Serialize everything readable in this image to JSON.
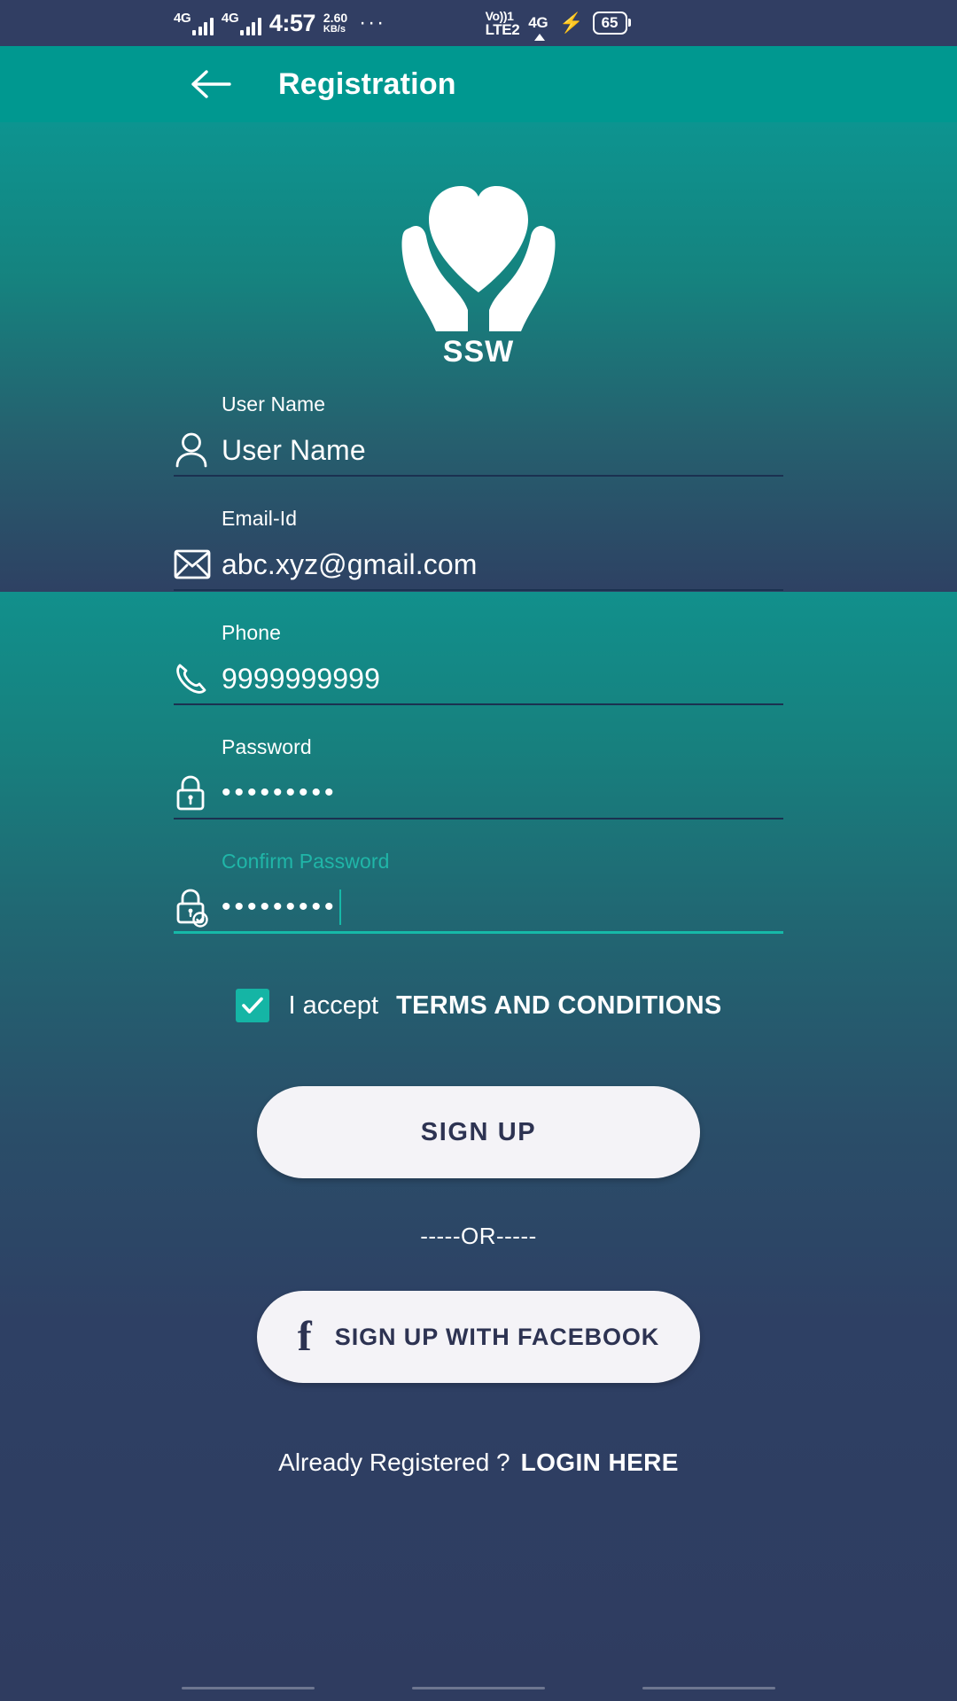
{
  "status_bar": {
    "network_1": "4G",
    "network_2": "4G",
    "time": "4:57",
    "data_rate_value": "2.60",
    "data_rate_unit": "KB/s",
    "overflow": "···",
    "volte_top": "Vo))1",
    "volte_bottom": "LTE2",
    "network_right": "4G",
    "charging": "⚡",
    "battery_level": "65"
  },
  "app_bar": {
    "back_icon": "arrow-left-icon",
    "title": "Registration"
  },
  "logo": {
    "icon": "heart-in-hands-icon",
    "text": "SSW"
  },
  "form": {
    "fields": [
      {
        "label": "User Name",
        "value": "User Name",
        "placeholder": "User Name",
        "icon": "person-icon",
        "focused": false,
        "masked": false
      },
      {
        "label": "Email-Id",
        "value": "abc.xyz@gmail.com",
        "placeholder": "Email-Id",
        "icon": "envelope-icon",
        "focused": false,
        "masked": false
      },
      {
        "label": "Phone",
        "value": "9999999999",
        "placeholder": "Phone",
        "icon": "phone-icon",
        "focused": false,
        "masked": false
      },
      {
        "label": "Password",
        "value": "•••••••••",
        "placeholder": "Password",
        "icon": "lock-icon",
        "focused": false,
        "masked": true
      },
      {
        "label": "Confirm Password",
        "value": "•••••••••",
        "placeholder": "Confirm Password",
        "icon": "lock-check-icon",
        "focused": true,
        "masked": true
      }
    ]
  },
  "terms": {
    "checked": true,
    "accept_text": "I accept",
    "link_text": "TERMS AND CONDITIONS"
  },
  "actions": {
    "signup_label": "SIGN UP",
    "or_text": "-----OR-----",
    "facebook_icon": "facebook-f-icon",
    "facebook_label": "SIGN UP WITH FACEBOOK"
  },
  "footer": {
    "already_text": "Already Registered ?",
    "login_link": "LOGIN HERE"
  },
  "colors": {
    "app_bar": "#009890",
    "status_bar": "#313e63",
    "accent_teal": "#16b9a8",
    "gradient_top": "#0d9490",
    "gradient_bottom": "#2f3c60",
    "button_face": "#f4f3f7",
    "button_text": "#2d3352"
  }
}
